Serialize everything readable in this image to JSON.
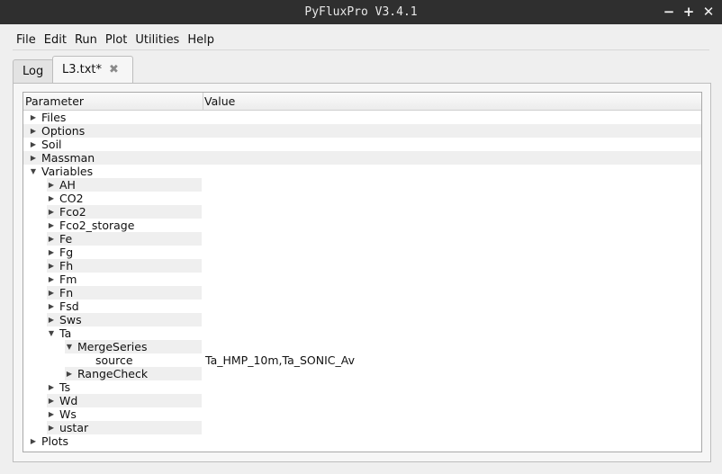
{
  "window": {
    "title": "PyFluxPro V3.4.1",
    "minimize": "−",
    "maximize": "+",
    "close": "✕"
  },
  "menu": [
    "File",
    "Edit",
    "Run",
    "Plot",
    "Utilities",
    "Help"
  ],
  "tabs": [
    {
      "label": "Log",
      "active": false
    },
    {
      "label": "L3.txt*",
      "active": true,
      "close_icon": "close-icon"
    }
  ],
  "tree": {
    "headers": {
      "parameter": "Parameter",
      "value": "Value"
    },
    "rows": [
      {
        "label": "Files",
        "depth": 0,
        "expander": "collapsed",
        "value": ""
      },
      {
        "label": "Options",
        "depth": 0,
        "expander": "collapsed",
        "value": ""
      },
      {
        "label": "Soil",
        "depth": 0,
        "expander": "collapsed",
        "value": ""
      },
      {
        "label": "Massman",
        "depth": 0,
        "expander": "collapsed",
        "value": ""
      },
      {
        "label": "Variables",
        "depth": 0,
        "expander": "expanded",
        "value": ""
      },
      {
        "label": "AH",
        "depth": 1,
        "expander": "collapsed",
        "value": ""
      },
      {
        "label": "CO2",
        "depth": 1,
        "expander": "collapsed",
        "value": ""
      },
      {
        "label": "Fco2",
        "depth": 1,
        "expander": "collapsed",
        "value": ""
      },
      {
        "label": "Fco2_storage",
        "depth": 1,
        "expander": "collapsed",
        "value": ""
      },
      {
        "label": "Fe",
        "depth": 1,
        "expander": "collapsed",
        "value": ""
      },
      {
        "label": "Fg",
        "depth": 1,
        "expander": "collapsed",
        "value": ""
      },
      {
        "label": "Fh",
        "depth": 1,
        "expander": "collapsed",
        "value": ""
      },
      {
        "label": "Fm",
        "depth": 1,
        "expander": "collapsed",
        "value": ""
      },
      {
        "label": "Fn",
        "depth": 1,
        "expander": "collapsed",
        "value": ""
      },
      {
        "label": "Fsd",
        "depth": 1,
        "expander": "collapsed",
        "value": ""
      },
      {
        "label": "Sws",
        "depth": 1,
        "expander": "collapsed",
        "value": ""
      },
      {
        "label": "Ta",
        "depth": 1,
        "expander": "expanded",
        "value": ""
      },
      {
        "label": "MergeSeries",
        "depth": 2,
        "expander": "expanded",
        "value": ""
      },
      {
        "label": "source",
        "depth": 3,
        "expander": "none",
        "value": "Ta_HMP_10m,Ta_SONIC_Av"
      },
      {
        "label": "RangeCheck",
        "depth": 2,
        "expander": "collapsed",
        "value": ""
      },
      {
        "label": "Ts",
        "depth": 1,
        "expander": "collapsed",
        "value": ""
      },
      {
        "label": "Wd",
        "depth": 1,
        "expander": "collapsed",
        "value": ""
      },
      {
        "label": "Ws",
        "depth": 1,
        "expander": "collapsed",
        "value": ""
      },
      {
        "label": "ustar",
        "depth": 1,
        "expander": "collapsed",
        "value": ""
      },
      {
        "label": "Plots",
        "depth": 0,
        "expander": "collapsed",
        "value": ""
      }
    ]
  },
  "colors": {
    "titlebar": "#2f2f2f",
    "alt_row": "#efefef",
    "background": "#efefef"
  }
}
